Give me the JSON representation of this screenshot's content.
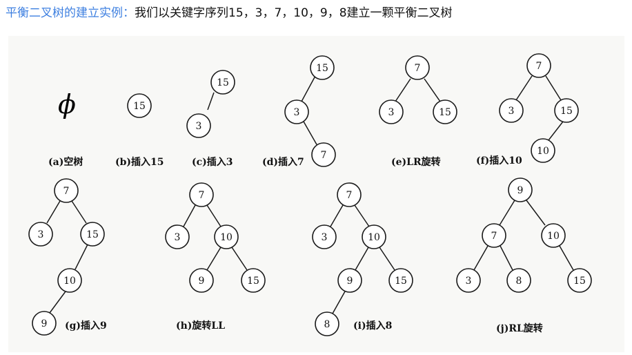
{
  "header": {
    "title": "平衡二叉树的建立实例：",
    "description": "我们以关键字序列15，3，7，10，9，8建立一颗平衡二叉树",
    "title_color": "#3d7fe0"
  },
  "figure": {
    "empty_symbol": "ϕ",
    "steps": [
      {
        "caption": "(a)空树",
        "nodes": []
      },
      {
        "caption": "(b)插入15",
        "nodes": [
          "15"
        ]
      },
      {
        "caption": "(c)插入3",
        "nodes": [
          "15",
          "3"
        ]
      },
      {
        "caption": "(d)插入7",
        "nodes": [
          "15",
          "3",
          "7"
        ]
      },
      {
        "caption": "(e)LR旋转",
        "nodes": [
          "7",
          "3",
          "15"
        ]
      },
      {
        "caption": "(f)插入10",
        "nodes": [
          "7",
          "3",
          "15",
          "10"
        ]
      },
      {
        "caption": "(g)插入9",
        "nodes": [
          "7",
          "3",
          "15",
          "10",
          "9"
        ]
      },
      {
        "caption": "(h)旋转LL",
        "nodes": [
          "7",
          "3",
          "10",
          "9",
          "15"
        ]
      },
      {
        "caption": "(i)插入8",
        "nodes": [
          "7",
          "3",
          "10",
          "9",
          "15",
          "8"
        ]
      },
      {
        "caption": "(j)RL旋转",
        "nodes": [
          "9",
          "7",
          "10",
          "3",
          "8",
          "15"
        ]
      }
    ]
  }
}
